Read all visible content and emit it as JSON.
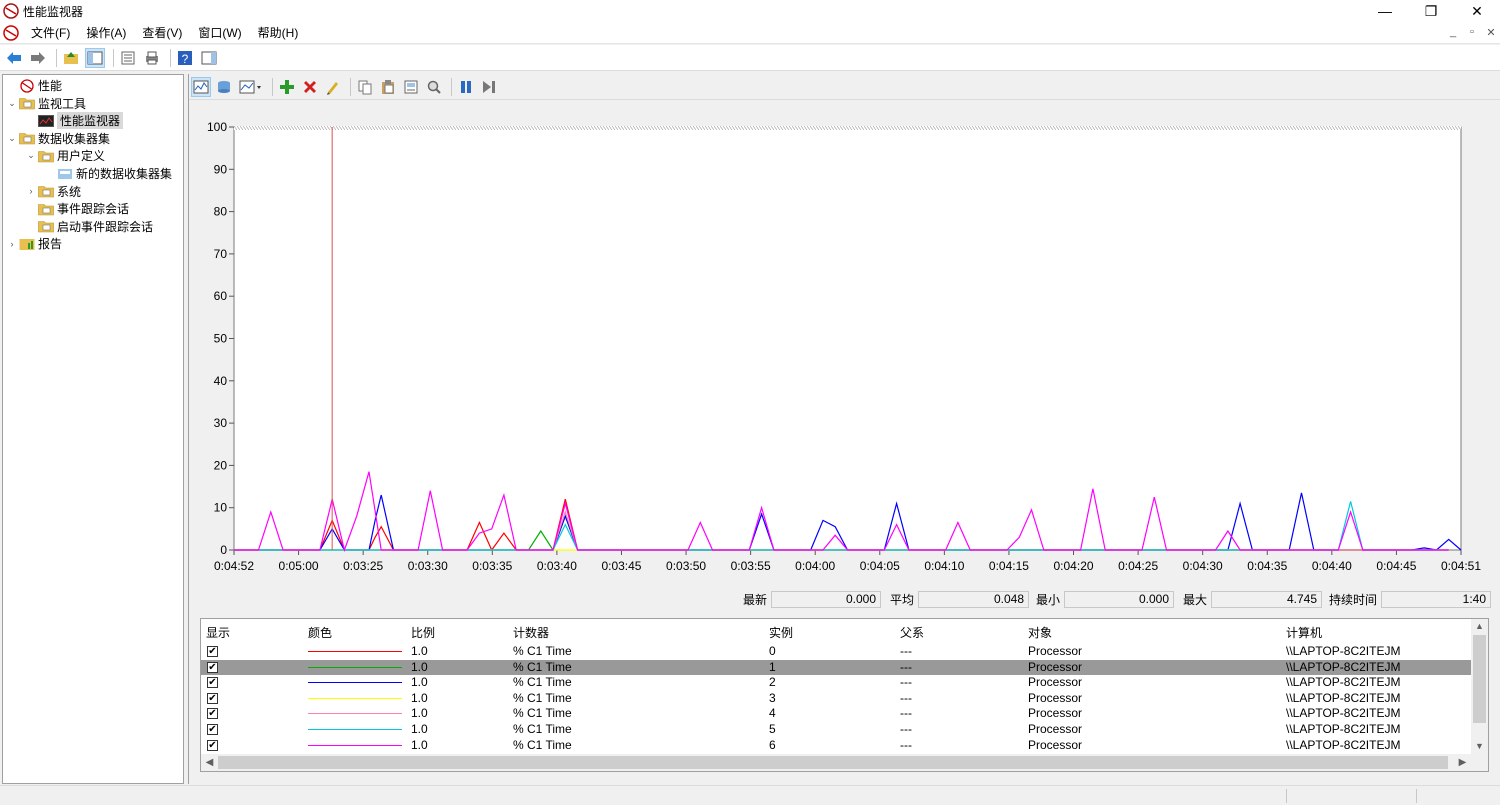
{
  "window": {
    "title": "性能监视器",
    "minimize_glyph": "—",
    "restore_glyph": "❐",
    "close_glyph": "✕"
  },
  "menu": {
    "items": [
      "文件(F)",
      "操作(A)",
      "查看(V)",
      "窗口(W)",
      "帮助(H)"
    ]
  },
  "mdi_controls": {
    "minimize": "_",
    "restore": "▫",
    "close": "✕"
  },
  "toolbar": {
    "icons": [
      "back-arrow-icon",
      "forward-arrow-icon",
      "up-folder-icon",
      "show-hide-tree-icon",
      "properties-icon",
      "export-list-icon",
      "help-icon",
      "show-hide-action-icon"
    ]
  },
  "tree": {
    "items": [
      {
        "label": "性能",
        "level": 0,
        "arrow": "",
        "icon": "performance-icon"
      },
      {
        "label": "监视工具",
        "level": 0,
        "arrow": "⌄",
        "icon": "folder-tools-icon"
      },
      {
        "label": "性能监视器",
        "level": 1,
        "arrow": "",
        "icon": "monitor-chart-icon",
        "selected": true
      },
      {
        "label": "数据收集器集",
        "level": 0,
        "arrow": "⌄",
        "icon": "folder-collector-icon"
      },
      {
        "label": "用户定义",
        "level": 1,
        "arrow": "⌄",
        "icon": "folder-user-icon"
      },
      {
        "label": "新的数据收集器集",
        "level": 2,
        "arrow": "",
        "icon": "collector-set-icon"
      },
      {
        "label": "系统",
        "level": 1,
        "arrow": "›",
        "icon": "folder-system-icon"
      },
      {
        "label": "事件跟踪会话",
        "level": 1,
        "arrow": "",
        "icon": "folder-trace-icon"
      },
      {
        "label": "启动事件跟踪会话",
        "level": 1,
        "arrow": "",
        "icon": "folder-trace-icon"
      },
      {
        "label": "报告",
        "level": 0,
        "arrow": "›",
        "icon": "folder-report-icon"
      }
    ]
  },
  "perf_toolbar": {
    "icons": [
      "view-current-activity-icon",
      "view-log-data-icon",
      "change-graph-type-icon",
      "add-counter-icon",
      "delete-counter-icon",
      "highlight-icon",
      "copy-properties-icon",
      "paste-counter-list-icon",
      "properties-icon",
      "zoom-icon",
      "freeze-display-icon",
      "update-data-icon"
    ]
  },
  "stats": {
    "latest_label": "最新",
    "latest_value": "0.000",
    "average_label": "平均",
    "average_value": "0.048",
    "minimum_label": "最小",
    "minimum_value": "0.000",
    "maximum_label": "最大",
    "maximum_value": "4.745",
    "duration_label": "持续时间",
    "duration_value": "1:40"
  },
  "legend": {
    "headers": {
      "show": "显示",
      "color": "颜色",
      "scale": "比例",
      "counter": "计数器",
      "instance": "实例",
      "parent": "父系",
      "object": "对象",
      "computer": "计算机"
    },
    "rows": [
      {
        "checked": "✔",
        "color": "#ff0000",
        "scale": "1.0",
        "counter": "% C1 Time",
        "instance": "0",
        "parent": "---",
        "object": "Processor",
        "computer": "\\\\LAPTOP-8C2ITEJM"
      },
      {
        "checked": "✔",
        "color": "#00b000",
        "scale": "1.0",
        "counter": "% C1 Time",
        "instance": "1",
        "parent": "---",
        "object": "Processor",
        "computer": "\\\\LAPTOP-8C2ITEJM",
        "selected": true
      },
      {
        "checked": "✔",
        "color": "#0000ff",
        "scale": "1.0",
        "counter": "% C1 Time",
        "instance": "2",
        "parent": "---",
        "object": "Processor",
        "computer": "\\\\LAPTOP-8C2ITEJM"
      },
      {
        "checked": "✔",
        "color": "#ffff00",
        "scale": "1.0",
        "counter": "% C1 Time",
        "instance": "3",
        "parent": "---",
        "object": "Processor",
        "computer": "\\\\LAPTOP-8C2ITEJM"
      },
      {
        "checked": "✔",
        "color": "#ff80b0",
        "scale": "1.0",
        "counter": "% C1 Time",
        "instance": "4",
        "parent": "---",
        "object": "Processor",
        "computer": "\\\\LAPTOP-8C2ITEJM"
      },
      {
        "checked": "✔",
        "color": "#00c8e0",
        "scale": "1.0",
        "counter": "% C1 Time",
        "instance": "5",
        "parent": "---",
        "object": "Processor",
        "computer": "\\\\LAPTOP-8C2ITEJM"
      },
      {
        "checked": "✔",
        "color": "#ff00ff",
        "scale": "1.0",
        "counter": "% C1 Time",
        "instance": "6",
        "parent": "---",
        "object": "Processor",
        "computer": "\\\\LAPTOP-8C2ITEJM"
      }
    ]
  },
  "chart_data": {
    "type": "line",
    "ylim": [
      0,
      100
    ],
    "yticks": [
      0,
      10,
      20,
      30,
      40,
      50,
      60,
      70,
      80,
      90,
      100
    ],
    "xticks": [
      "0:04:52",
      "0:05:00",
      "0:03:25",
      "0:03:30",
      "0:03:35",
      "0:03:40",
      "0:03:45",
      "0:03:50",
      "0:03:55",
      "0:04:00",
      "0:04:05",
      "0:04:10",
      "0:04:15",
      "0:04:20",
      "0:04:25",
      "0:04:30",
      "0:04:35",
      "0:04:40",
      "0:04:45",
      "0:04:51"
    ],
    "x_samples": 100,
    "current_sample": 8,
    "grid": false,
    "series": [
      {
        "name": "0",
        "color": "#ff0000",
        "points": [
          [
            0,
            0
          ],
          [
            7,
            0
          ],
          [
            8,
            7
          ],
          [
            9,
            0
          ],
          [
            11,
            0
          ],
          [
            11.5,
            3
          ],
          [
            12,
            5.5
          ],
          [
            13,
            0
          ],
          [
            19,
            0
          ],
          [
            20,
            6.5
          ],
          [
            21,
            0
          ],
          [
            22,
            4
          ],
          [
            23,
            0
          ],
          [
            26,
            0
          ],
          [
            27,
            12
          ],
          [
            28,
            0
          ],
          [
            99,
            0
          ]
        ]
      },
      {
        "name": "1",
        "color": "#00b000",
        "points": [
          [
            0,
            0
          ],
          [
            24,
            0
          ],
          [
            25,
            4.5
          ],
          [
            26,
            0
          ],
          [
            27,
            8
          ],
          [
            28,
            0
          ],
          [
            99,
            0
          ]
        ]
      },
      {
        "name": "2",
        "color": "#0000ff",
        "points": [
          [
            0,
            0
          ],
          [
            7,
            0
          ],
          [
            8,
            5
          ],
          [
            9,
            0
          ],
          [
            11,
            0
          ],
          [
            11.5,
            7
          ],
          [
            12,
            13
          ],
          [
            13,
            0
          ],
          [
            26,
            0
          ],
          [
            27,
            8
          ],
          [
            28,
            0
          ],
          [
            42,
            0
          ],
          [
            43,
            8.5
          ],
          [
            44,
            0
          ],
          [
            47,
            0
          ],
          [
            48,
            7
          ],
          [
            49,
            5.5
          ],
          [
            50,
            0
          ],
          [
            53,
            0
          ],
          [
            54,
            11
          ],
          [
            55,
            0
          ],
          [
            81,
            0
          ],
          [
            82,
            11
          ],
          [
            83,
            0
          ],
          [
            86,
            0
          ],
          [
            87,
            13.5
          ],
          [
            88,
            0
          ],
          [
            96,
            0
          ],
          [
            97,
            0.5
          ],
          [
            98,
            0
          ],
          [
            99,
            2.5
          ],
          [
            100,
            0
          ]
        ]
      },
      {
        "name": "3",
        "color": "#ffff00",
        "points": [
          [
            0,
            0
          ],
          [
            99,
            0
          ]
        ]
      },
      {
        "name": "4",
        "color": "#ff80b0",
        "points": [
          [
            0,
            0
          ],
          [
            26,
            0
          ],
          [
            27,
            9
          ],
          [
            28,
            0
          ],
          [
            99,
            0
          ]
        ]
      },
      {
        "name": "5",
        "color": "#00c8e0",
        "points": [
          [
            0,
            0
          ],
          [
            26,
            0
          ],
          [
            27,
            6
          ],
          [
            28,
            0
          ],
          [
            90,
            0
          ],
          [
            91,
            11.5
          ],
          [
            92,
            0
          ],
          [
            99,
            0
          ]
        ]
      },
      {
        "name": "6",
        "color": "#ff00ff",
        "points": [
          [
            0,
            0
          ],
          [
            2,
            0
          ],
          [
            3,
            9
          ],
          [
            4,
            0
          ],
          [
            7,
            0
          ],
          [
            8,
            12
          ],
          [
            9,
            0
          ],
          [
            10,
            8
          ],
          [
            11,
            18.5
          ],
          [
            12,
            0
          ],
          [
            15,
            0
          ],
          [
            16,
            14
          ],
          [
            17,
            0
          ],
          [
            19,
            0
          ],
          [
            20,
            4
          ],
          [
            21,
            5
          ],
          [
            22,
            13
          ],
          [
            23,
            0
          ],
          [
            26,
            0
          ],
          [
            27,
            11
          ],
          [
            28,
            0
          ],
          [
            37,
            0
          ],
          [
            38,
            6.5
          ],
          [
            39,
            0
          ],
          [
            42,
            0
          ],
          [
            43,
            10
          ],
          [
            44,
            0
          ],
          [
            48,
            0
          ],
          [
            49,
            3.5
          ],
          [
            50,
            0
          ],
          [
            53,
            0
          ],
          [
            54,
            6
          ],
          [
            55,
            0
          ],
          [
            58,
            0
          ],
          [
            59,
            6.5
          ],
          [
            60,
            0
          ],
          [
            63,
            0
          ],
          [
            64,
            3
          ],
          [
            65,
            9.5
          ],
          [
            66,
            0
          ],
          [
            69,
            0
          ],
          [
            70,
            14.5
          ],
          [
            71,
            0
          ],
          [
            74,
            0
          ],
          [
            75,
            12.5
          ],
          [
            76,
            0
          ],
          [
            80,
            0
          ],
          [
            81,
            4.5
          ],
          [
            82,
            0
          ],
          [
            90,
            0
          ],
          [
            91,
            9
          ],
          [
            92,
            0
          ],
          [
            99,
            0
          ]
        ]
      }
    ]
  }
}
